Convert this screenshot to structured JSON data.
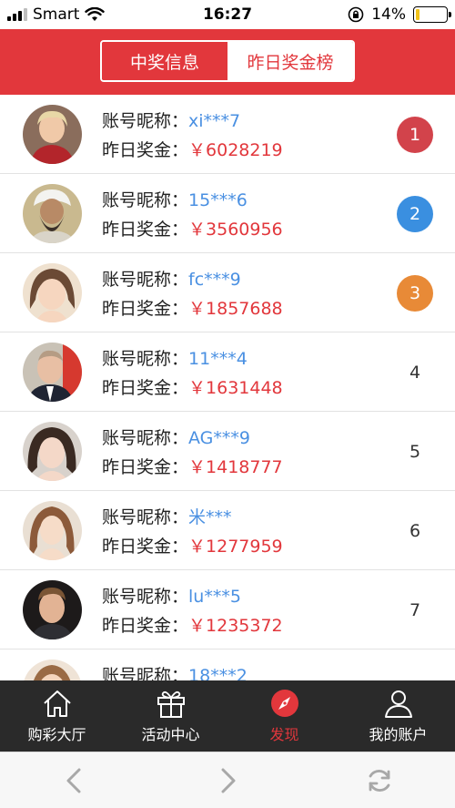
{
  "status_bar": {
    "carrier": "Smart",
    "time": "16:27",
    "battery": "14%",
    "battery_level": 0.14
  },
  "header": {
    "segments": [
      "中奖信息",
      "昨日奖金榜"
    ],
    "selected_segment": "中奖信息"
  },
  "list": {
    "nick_label": "账号昵称：",
    "prize_label": "昨日奖金：",
    "rows": [
      {
        "nickname": "xi***7",
        "prize": "￥6028219",
        "rank": "1"
      },
      {
        "nickname": "15***6",
        "prize": "￥3560956",
        "rank": "2"
      },
      {
        "nickname": "fc***9",
        "prize": "￥1857688",
        "rank": "3"
      },
      {
        "nickname": "11***4",
        "prize": "￥1631448",
        "rank": "4"
      },
      {
        "nickname": "AG***9",
        "prize": "￥1418777",
        "rank": "5"
      },
      {
        "nickname": "米***",
        "prize": "￥1277959",
        "rank": "6"
      },
      {
        "nickname": "lu***5",
        "prize": "￥1235372",
        "rank": "7"
      },
      {
        "nickname": "18***2",
        "prize": "",
        "rank": ""
      }
    ]
  },
  "tab_bar": {
    "items": [
      {
        "label": "购彩大厅",
        "icon": "home-icon"
      },
      {
        "label": "活动中心",
        "icon": "gift-icon"
      },
      {
        "label": "发现",
        "icon": "compass-icon"
      },
      {
        "label": "我的账户",
        "icon": "user-icon"
      }
    ],
    "active": "发现"
  },
  "browser_toolbar": {
    "icons": [
      "back-icon",
      "forward-icon",
      "reload-icon"
    ]
  },
  "colors": {
    "brand_red": "#e2373c",
    "nickname_blue": "#4a90e2",
    "rank1": "#d2434b",
    "rank2": "#3a8fe0",
    "rank3": "#e88a37",
    "tabbar_bg": "#2a2a2a"
  }
}
